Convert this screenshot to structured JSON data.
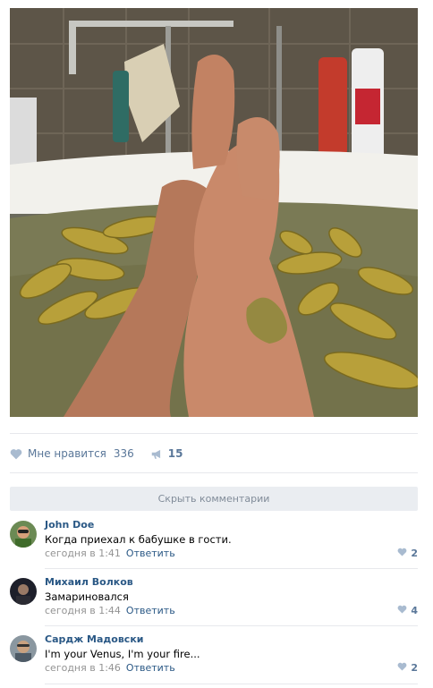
{
  "post": {
    "photo_icon": "post-photo"
  },
  "actions": {
    "like_label": "Мне нравится",
    "like_count": "336",
    "share_count": "15",
    "like_icon": "heart-icon",
    "share_icon": "megaphone-icon"
  },
  "comments_toggle": {
    "label": "Скрыть комментарии"
  },
  "comments": [
    {
      "author": "John Doe",
      "text": "Когда приехал к бабушке в гости.",
      "time": "сегодня в 1:41",
      "reply": "Ответить",
      "likes": "2"
    },
    {
      "author": "Михаил Волков",
      "text": "Замариновался",
      "time": "сегодня в 1:44",
      "reply": "Ответить",
      "likes": "4"
    },
    {
      "author": "Сардж Мадовски",
      "text": "I'm your Venus, I'm your fire...",
      "time": "сегодня в 1:46",
      "reply": "Ответить",
      "likes": "2"
    }
  ],
  "colors": {
    "link": "#2a5885",
    "muted": "#939393",
    "accent": "#5a7799",
    "toggle_bg": "#eaedf1"
  }
}
